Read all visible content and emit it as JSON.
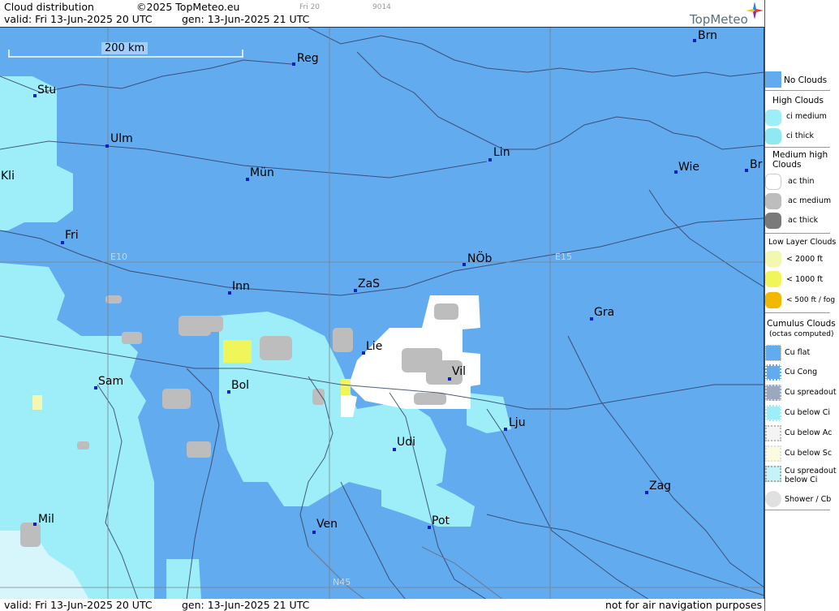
{
  "header": {
    "title": "Cloud distribution",
    "copyright": "©2025 TopMeteo.eu",
    "tab_label": "Fri 20",
    "code": "9014",
    "valid": "valid:  Fri  13-Jun-2025  20 UTC",
    "gen": "gen: 13-Jun-2025 21 UTC",
    "logo": "TopMeteo"
  },
  "footer": {
    "valid": "valid:  Fri  13-Jun-2025  20 UTC",
    "gen": "gen: 13-Jun-2025 21 UTC",
    "disclaimer": "not for air navigation purposes"
  },
  "map": {
    "scale_label": "200 km",
    "grid_labels": {
      "e10": "E10",
      "e15": "E15",
      "n45": "N45"
    },
    "cities": [
      {
        "name": "Brn"
      },
      {
        "name": "Reg"
      },
      {
        "name": "Stu"
      },
      {
        "name": "Ulm"
      },
      {
        "name": "Lin"
      },
      {
        "name": "Wie"
      },
      {
        "name": "Br"
      },
      {
        "name": "Kli"
      },
      {
        "name": "Mün"
      },
      {
        "name": "Fri"
      },
      {
        "name": "NÖb"
      },
      {
        "name": "Inn"
      },
      {
        "name": "ZaS"
      },
      {
        "name": "Gra"
      },
      {
        "name": "Lie"
      },
      {
        "name": "Sam"
      },
      {
        "name": "Bol"
      },
      {
        "name": "Vil"
      },
      {
        "name": "Lju"
      },
      {
        "name": "Udi"
      },
      {
        "name": "Zag"
      },
      {
        "name": "Mil"
      },
      {
        "name": "Ven"
      },
      {
        "name": "Pot"
      }
    ]
  },
  "legend": {
    "no_clouds": "No Clouds",
    "high_clouds": "High Clouds",
    "ci_medium": "ci medium",
    "ci_thick": "ci thick",
    "medium_high": "Medium high Clouds",
    "ac_thin": "ac thin",
    "ac_medium": "ac medium",
    "ac_thick": "ac thick",
    "low_layer": "Low Layer Clouds",
    "lt2000": "< 2000 ft",
    "lt1000": "< 1000 ft",
    "lt500": "< 500 ft / fog",
    "cumulus": "Cumulus Clouds",
    "octas": "(octas computed)",
    "cu_flat": "Cu flat",
    "cu_cong": "Cu Cong",
    "cu_spreadout": "Cu spreadout",
    "cu_below_ci": "Cu below Ci",
    "cu_below_ac": "Cu below Ac",
    "cu_below_sc": "Cu below Sc",
    "cu_spreadout_below_ci": "Cu spreadout below Ci",
    "shower_cb": "Shower / Cb"
  },
  "colors": {
    "no_clouds": "#62abee",
    "ci_medium": "#9eeefa",
    "ci_thick": "#8fe9f2",
    "ac_thin": "#ffffff",
    "ac_medium": "#bdbdbd",
    "ac_thick": "#7a7a7a",
    "lt2000": "#f3f7b0",
    "lt1000": "#f0f55a",
    "lt500": "#f2b800"
  }
}
